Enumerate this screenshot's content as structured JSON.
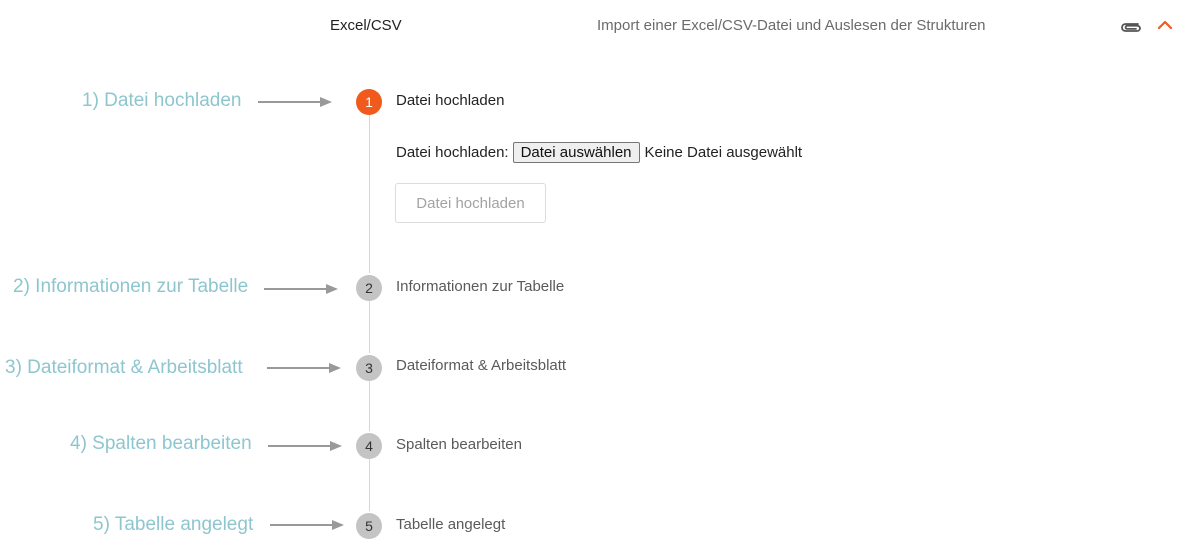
{
  "header": {
    "title": "Excel/CSV",
    "description": "Import einer Excel/CSV-Datei und Auslesen der Strukturen",
    "attach_icon": "paperclip-icon",
    "collapse_icon": "chevron-up-icon",
    "accent_color": "#f15a1d"
  },
  "annotations": [
    {
      "label": "1) Datei hochladen"
    },
    {
      "label": "2) Informationen zur Tabelle"
    },
    {
      "label": "3) Dateiformat & Arbeitsblatt"
    },
    {
      "label": "4) Spalten bearbeiten"
    },
    {
      "label": "5) Tabelle angelegt"
    }
  ],
  "steps": [
    {
      "number": "1",
      "label": "Datei hochladen",
      "active": true
    },
    {
      "number": "2",
      "label": "Informationen zur Tabelle",
      "active": false
    },
    {
      "number": "3",
      "label": "Dateiformat & Arbeitsblatt",
      "active": false
    },
    {
      "number": "4",
      "label": "Spalten bearbeiten",
      "active": false
    },
    {
      "number": "5",
      "label": "Tabelle angelegt",
      "active": false
    }
  ],
  "upload": {
    "field_label": "Datei hochladen:",
    "choose_button": "Datei auswählen",
    "no_file_text": "Keine Datei ausgewählt",
    "submit_button": "Datei hochladen"
  },
  "colors": {
    "annotation": "#8dc6cf",
    "inactive_step": "#c4c4c4"
  }
}
